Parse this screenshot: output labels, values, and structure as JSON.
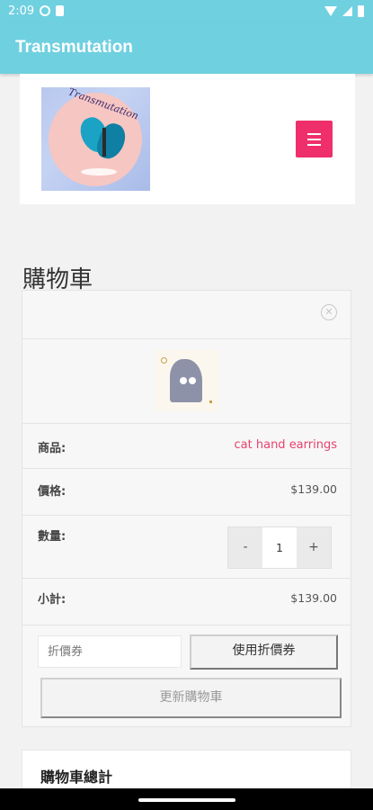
{
  "status_bar": {
    "time": "2:09",
    "icons": [
      "settings-icon",
      "sim-card-icon",
      "wifi-icon",
      "signal-icon",
      "battery-icon"
    ]
  },
  "app_bar": {
    "title": "Transmutation"
  },
  "header": {
    "logo_text": "Transmutation",
    "menu_icon": "hamburger-menu-icon",
    "accent_color": "#ee2f6b"
  },
  "page": {
    "title": "購物車"
  },
  "cart": {
    "remove_icon": "close-circle-icon",
    "product_label": "商品:",
    "product_name": "cat hand earrings",
    "price_label": "價格:",
    "price": "$139.00",
    "quantity_label": "數量:",
    "quantity": "1",
    "minus": "-",
    "plus": "+",
    "subtotal_label": "小計:",
    "subtotal": "$139.00",
    "coupon_placeholder": "折價券",
    "apply_coupon": "使用折價券",
    "update_cart": "更新購物車"
  },
  "totals": {
    "title": "購物車總計"
  },
  "colors": {
    "app_bar": "#6fd0e0",
    "link": "#e8426d"
  }
}
